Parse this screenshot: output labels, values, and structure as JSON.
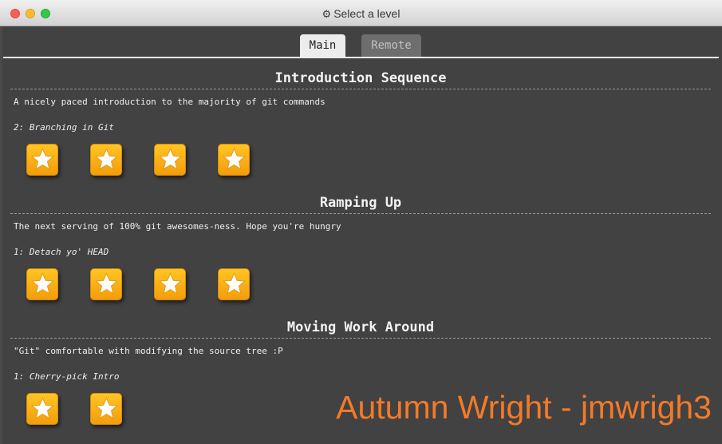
{
  "window": {
    "title": "Select a level",
    "title_icon": "gear-icon"
  },
  "tabs": [
    {
      "label": "Main",
      "active": true
    },
    {
      "label": "Remote",
      "active": false
    }
  ],
  "sections": [
    {
      "title": "Introduction Sequence",
      "description": "A nicely paced introduction to the majority of git commands",
      "current_level": "2: Branching in Git",
      "level_count": 4
    },
    {
      "title": "Ramping Up",
      "description": "The next serving of 100% git awesomes-ness. Hope you're hungry",
      "current_level": "1: Detach yo' HEAD",
      "level_count": 4
    },
    {
      "title": "Moving Work Around",
      "description": "\"Git\" comfortable with modifying the source tree :P",
      "current_level": "1: Cherry-pick Intro",
      "level_count": 2
    }
  ],
  "watermark": "Autumn Wright - jmwrigh3",
  "colors": {
    "star_tile": "#f7b018",
    "star": "#ffffff",
    "watermark": "#f47a27",
    "background": "#424242"
  }
}
